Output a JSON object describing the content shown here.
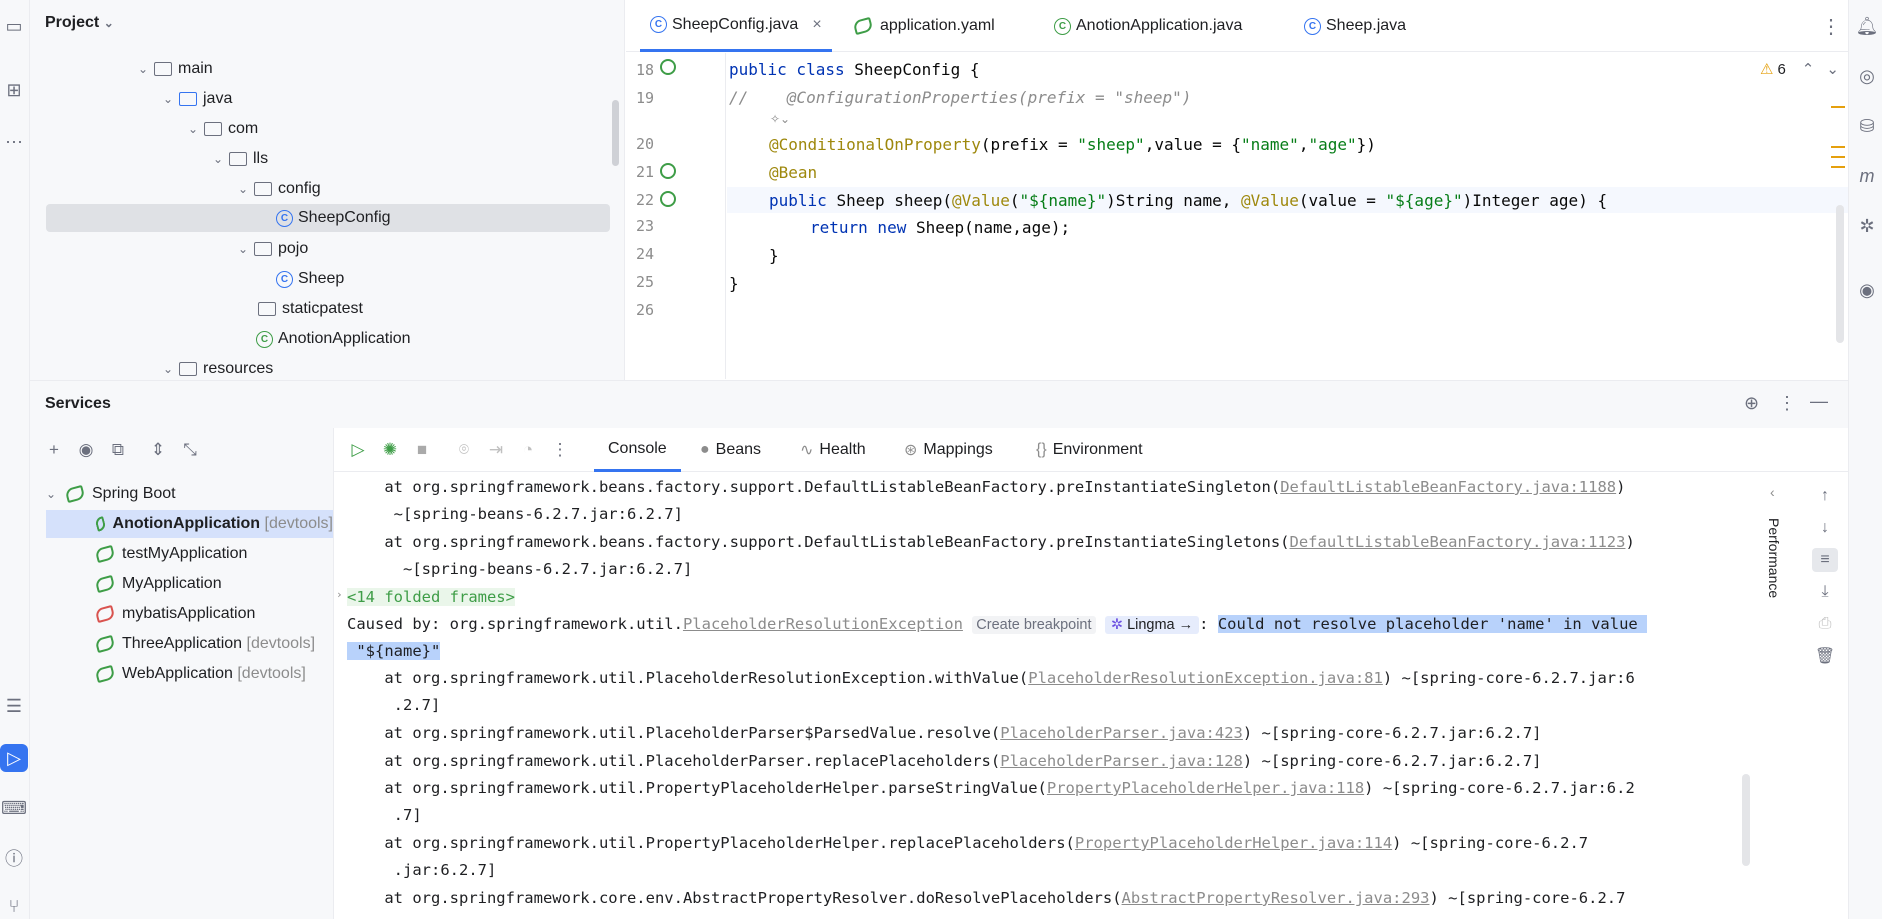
{
  "project": {
    "title": "Project",
    "tree": [
      {
        "label": "main",
        "kind": "folder",
        "depth": 0,
        "expanded": true
      },
      {
        "label": "java",
        "kind": "source-folder",
        "depth": 1,
        "expanded": true
      },
      {
        "label": "com",
        "kind": "package",
        "depth": 2,
        "expanded": true
      },
      {
        "label": "lls",
        "kind": "package",
        "depth": 3,
        "expanded": true
      },
      {
        "label": "config",
        "kind": "package",
        "depth": 4,
        "expanded": true
      },
      {
        "label": "SheepConfig",
        "kind": "class",
        "depth": 5,
        "selected": true
      },
      {
        "label": "pojo",
        "kind": "package",
        "depth": 4,
        "expanded": true
      },
      {
        "label": "Sheep",
        "kind": "class",
        "depth": 5
      },
      {
        "label": "staticpatest",
        "kind": "package",
        "depth": 4
      },
      {
        "label": "AnotionApplication",
        "kind": "spring-class",
        "depth": 4
      },
      {
        "label": "resources",
        "kind": "resources-folder",
        "depth": 1,
        "expanded": true
      }
    ]
  },
  "editor": {
    "tabs": [
      {
        "label": "SheepConfig.java",
        "icon": "class-icon",
        "active": true,
        "close": "×"
      },
      {
        "label": "application.yaml",
        "icon": "leaf-icon"
      },
      {
        "label": "AnotionApplication.java",
        "icon": "spring-class-icon"
      },
      {
        "label": "Sheep.java",
        "icon": "class-icon"
      }
    ],
    "warnings": "6",
    "lines": [
      {
        "num": "18"
      },
      {
        "num": "19"
      },
      {
        "num": ""
      },
      {
        "num": "20"
      },
      {
        "num": "21"
      },
      {
        "num": "22"
      },
      {
        "num": "23"
      },
      {
        "num": "24"
      },
      {
        "num": "25"
      },
      {
        "num": "26"
      }
    ],
    "code": {
      "l18_kw": "public class ",
      "l18_rest": "SheepConfig {",
      "l19": "//    @ConfigurationProperties(prefix = \"sheep\")",
      "l20_ann": "@ConditionalOnProperty",
      "l20_a": "(prefix = ",
      "l20_s1": "\"sheep\"",
      "l20_b": ",value = {",
      "l20_s2": "\"name\"",
      "l20_c": ",",
      "l20_s3": "\"age\"",
      "l20_d": "})",
      "l21_ann": "@Bean",
      "l22_kw": "public ",
      "l22_a": "Sheep sheep(",
      "l22_ann1": "@Value",
      "l22_b": "(",
      "l22_s1": "\"${name}\"",
      "l22_c": ")String name, ",
      "l22_ann2": "@Value",
      "l22_d": "(value = ",
      "l22_s2": "\"${age}\"",
      "l22_e": ")Integer age) {",
      "l23_kw": "return new ",
      "l23_rest": "Sheep(name,age);",
      "l24": "}",
      "l25": "}"
    }
  },
  "services": {
    "title": "Services",
    "root": "Spring Boot",
    "apps": [
      {
        "name": "AnotionApplication",
        "suffix": "[devtools]",
        "selected": true
      },
      {
        "name": "testMyApplication",
        "suffix": ""
      },
      {
        "name": "MyApplication",
        "suffix": ""
      },
      {
        "name": "mybatisApplication",
        "suffix": "",
        "error": true
      },
      {
        "name": "ThreeApplication",
        "suffix": "[devtools]"
      },
      {
        "name": "WebApplication",
        "suffix": "[devtools]"
      }
    ],
    "console_tabs": [
      "Console",
      "Beans",
      "Health",
      "Mappings",
      "Environment"
    ],
    "performance_label": "Performance"
  },
  "console": {
    "l1": "    at org.springframework.beans.factory.support.DefaultListableBeanFactory.preInstantiateSingleton(",
    "l1_link": "DefaultListableBeanFactory.java:1188",
    "l1_end": ")",
    "l2": "     ~[spring-beans-6.2.7.jar:6.2.7]",
    "l3": "    at org.springframework.beans.factory.support.DefaultListableBeanFactory.preInstantiateSingletons(",
    "l3_link": "DefaultListableBeanFactory.java:1123",
    "l3_end": ")",
    "l4": "      ~[spring-beans-6.2.7.jar:6.2.7]",
    "folded": "<14 folded frames>",
    "caused_prefix": "Caused by: org.springframework.util.",
    "caused_link": "PlaceholderResolutionException",
    "create_breakpoint": "Create breakpoint",
    "lingma": "Lingma →",
    "colon": ": ",
    "message1": "Could not resolve placeholder 'name' in value ",
    "message2": " \"${name}\"",
    "l7": "    at org.springframework.util.PlaceholderResolutionException.withValue(",
    "l7_link": "PlaceholderResolutionException.java:81",
    "l7_end": ") ~[spring-core-6.2.7.jar:6",
    "l8": "     .2.7]",
    "l9": "    at org.springframework.util.PlaceholderParser$ParsedValue.resolve(",
    "l9_link": "PlaceholderParser.java:423",
    "l9_end": ") ~[spring-core-6.2.7.jar:6.2.7]",
    "l10": "    at org.springframework.util.PlaceholderParser.replacePlaceholders(",
    "l10_link": "PlaceholderParser.java:128",
    "l10_end": ") ~[spring-core-6.2.7.jar:6.2.7]",
    "l11": "    at org.springframework.util.PropertyPlaceholderHelper.parseStringValue(",
    "l11_link": "PropertyPlaceholderHelper.java:118",
    "l11_end": ") ~[spring-core-6.2.7.jar:6.2",
    "l12": "     .7]",
    "l13": "    at org.springframework.util.PropertyPlaceholderHelper.replacePlaceholders(",
    "l13_link": "PropertyPlaceholderHelper.java:114",
    "l13_end": ") ~[spring-core-6.2.7",
    "l14": "     .jar:6.2.7]",
    "l15": "    at org.springframework.core.env.AbstractPropertyResolver.doResolvePlaceholders(",
    "l15_link": "AbstractPropertyResolver.java:293",
    "l15_end": ") ~[spring-core-6.2.7"
  },
  "colors": {
    "accent": "#3574f0",
    "spring": "#3e9d47",
    "selection": "#d5e1fb"
  }
}
